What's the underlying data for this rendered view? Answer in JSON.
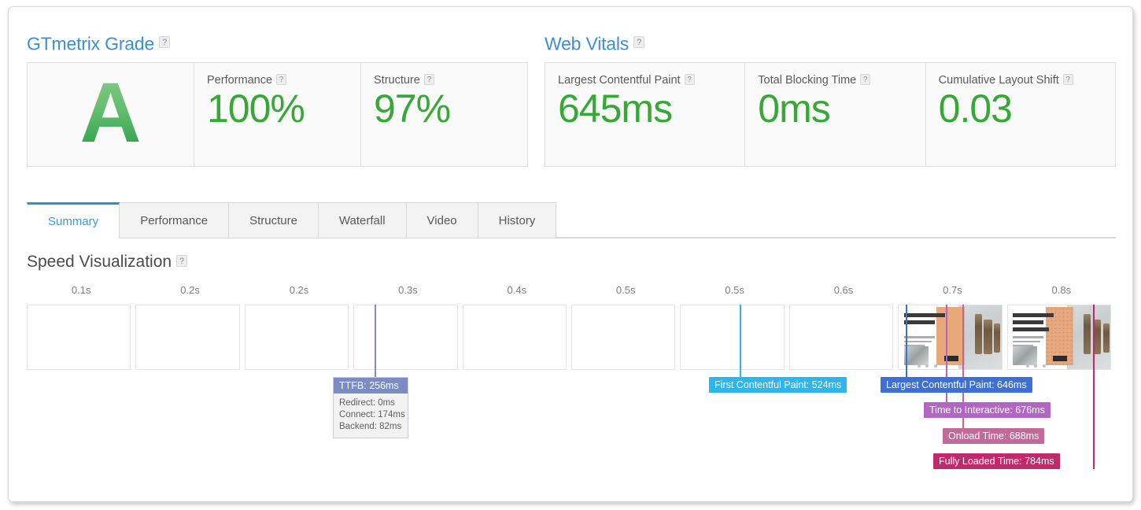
{
  "grade_section": {
    "title": "GTmetrix Grade",
    "help": "?",
    "grade": "A",
    "metrics": [
      {
        "label": "Performance",
        "value": "100%"
      },
      {
        "label": "Structure",
        "value": "97%"
      }
    ]
  },
  "vitals_section": {
    "title": "Web Vitals",
    "help": "?",
    "metrics": [
      {
        "label": "Largest Contentful Paint",
        "value": "645ms"
      },
      {
        "label": "Total Blocking Time",
        "value": "0ms"
      },
      {
        "label": "Cumulative Layout Shift",
        "value": "0.03"
      }
    ]
  },
  "tabs": [
    {
      "label": "Summary",
      "active": true
    },
    {
      "label": "Performance",
      "active": false
    },
    {
      "label": "Structure",
      "active": false
    },
    {
      "label": "Waterfall",
      "active": false
    },
    {
      "label": "Video",
      "active": false
    },
    {
      "label": "History",
      "active": false
    }
  ],
  "speed_visualization": {
    "title": "Speed Visualization",
    "help": "?",
    "ticks": [
      "0.1s",
      "0.2s",
      "0.2s",
      "0.3s",
      "0.4s",
      "0.5s",
      "0.5s",
      "0.6s",
      "0.7s",
      "0.8s"
    ],
    "frames": [
      {
        "rendered": false
      },
      {
        "rendered": false
      },
      {
        "rendered": false
      },
      {
        "rendered": false
      },
      {
        "rendered": false
      },
      {
        "rendered": false
      },
      {
        "rendered": false
      },
      {
        "rendered": false
      },
      {
        "rendered": true
      },
      {
        "rendered": true
      }
    ],
    "ttfb": {
      "title": "TTFB: 256ms",
      "rows": [
        "Redirect: 0ms",
        "Connect: 174ms",
        "Backend: 82ms"
      ]
    },
    "markers": [
      {
        "name": "ttfb",
        "label": "TTFB: 256ms",
        "time_ms": 256,
        "color": "#7b8cc4"
      },
      {
        "name": "fcp",
        "label": "First Contentful Paint: 524ms",
        "time_ms": 524,
        "color": "#2cb6ee"
      },
      {
        "name": "lcp",
        "label": "Largest Contentful Paint: 646ms",
        "time_ms": 646,
        "color": "#3d6fd4"
      },
      {
        "name": "tti",
        "label": "Time to Interactive: 676ms",
        "time_ms": 676,
        "color": "#b266c4"
      },
      {
        "name": "onload",
        "label": "Onload Time: 688ms",
        "time_ms": 688,
        "color": "#c16a9a"
      },
      {
        "name": "flt",
        "label": "Fully Loaded Time: 784ms",
        "time_ms": 784,
        "color": "#c0296a"
      }
    ]
  },
  "colors": {
    "accent_blue": "#3e8fd0",
    "score_green": "#36a836",
    "tab_active": "#2b8fd4"
  }
}
